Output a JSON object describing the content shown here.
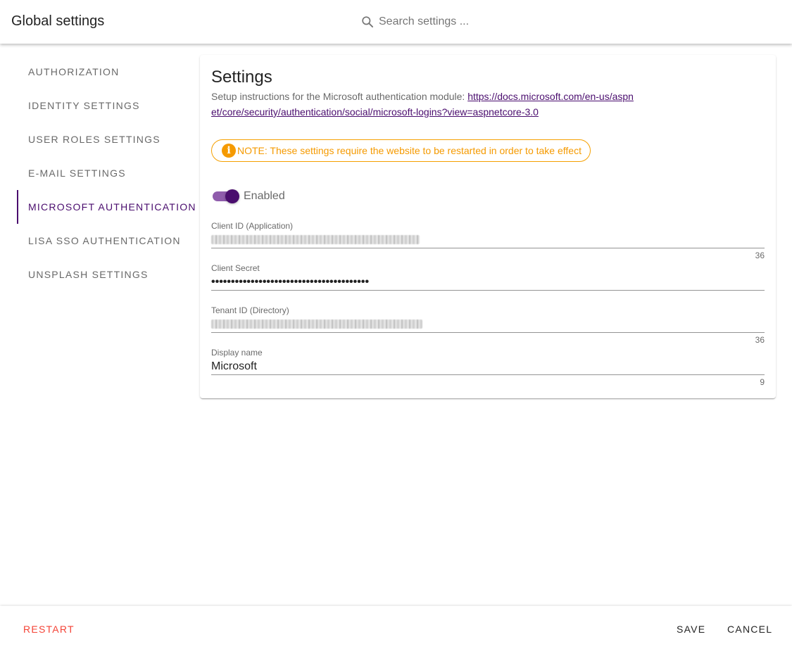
{
  "header": {
    "title": "Global settings",
    "search_placeholder": "Search settings ...",
    "search_icon": "search-icon"
  },
  "sidebar": {
    "items": [
      {
        "label": "AUTHORIZATION",
        "active": false
      },
      {
        "label": "IDENTITY SETTINGS",
        "active": false
      },
      {
        "label": "USER ROLES SETTINGS",
        "active": false
      },
      {
        "label": "E-MAIL SETTINGS",
        "active": false
      },
      {
        "label": "MICROSOFT AUTHENTICATION",
        "active": true
      },
      {
        "label": "LISA SSO AUTHENTICATION",
        "active": false
      },
      {
        "label": "UNSPLASH SETTINGS",
        "active": false
      }
    ]
  },
  "settings": {
    "title": "Settings",
    "description": "Setup instructions for the Microsoft authentication module: ",
    "link": "https://docs.microsoft.com/en-us/aspnet/core/security/authentication/social/microsoft-logins?view=aspnetcore-3.0",
    "note": "NOTE: These settings require the website to be restarted in order to take effect",
    "note_icon": "info-icon",
    "toggle": {
      "label": "Enabled",
      "on": true
    },
    "fields": {
      "client_id": {
        "label": "Client ID (Application)",
        "counter": "36"
      },
      "client_secret": {
        "label": "Client Secret",
        "value": "••••••••••••••••••••••••••••••••••••••••"
      },
      "tenant_id": {
        "label": "Tenant ID (Directory)",
        "counter": "36"
      },
      "display_name": {
        "label": "Display name",
        "value": "Microsoft",
        "counter": "9"
      }
    }
  },
  "footer": {
    "restart": "RESTART",
    "save": "SAVE",
    "cancel": "CANCEL"
  },
  "colors": {
    "accent": "#4a0d6e",
    "warning": "#f59a00",
    "danger": "#f44336"
  }
}
